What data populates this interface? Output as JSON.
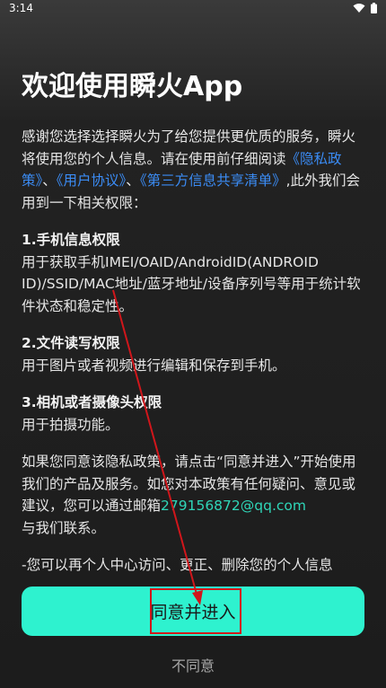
{
  "status_bar": {
    "time": "3:14"
  },
  "title": "欢迎使用瞬火App",
  "intro": {
    "text_1": "感谢您选择选择瞬火为了给您提供更优质的服务，瞬火将使用您的个人信息。请在使用前仔细阅读",
    "privacy_link": "《隐私政策》",
    "sep_1": "、",
    "user_agreement_link": "《用户协议》",
    "sep_2": "、",
    "third_party_link": "《第三方信息共享清单》",
    "text_2": ",此外我们会用到一下相关权限："
  },
  "permissions": [
    {
      "title": "1.手机信息权限",
      "desc": "用于获取手机IMEI/OAID/AndroidID(ANDROID ID)/SSID/MAC地址/蓝牙地址/设备序列号等用于统计软件状态和稳定性。"
    },
    {
      "title": "2.文件读写权限",
      "desc": "用于图片或者视频进行编辑和保存到手机。"
    },
    {
      "title": "3.相机或者摄像头权限",
      "desc": "用于拍摄功能。"
    }
  ],
  "consent": {
    "text_1": "如果您同意该隐私政策，请点击“同意并进入”开始使用我们的产品及服务。如您对本政策有任何疑问、意见或建议，您可以通过邮箱",
    "email": "279156872@qq.com",
    "text_2": "与我们联系。"
  },
  "footer_note": "-您可以再个人中心访问、更正、删除您的个人信息",
  "buttons": {
    "agree": "同意并进入",
    "disagree": "不同意"
  },
  "colors": {
    "accent": "#2ef2cf",
    "link": "#3b8cf5",
    "email": "#2fd6b8",
    "annotation": "#d0161b"
  },
  "icons": [
    "wifi-icon",
    "battery-icon"
  ]
}
